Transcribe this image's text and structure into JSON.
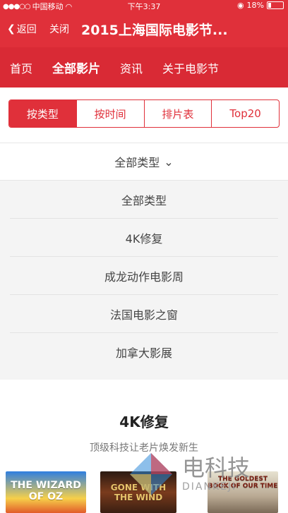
{
  "statusbar": {
    "carrier": "中国移动",
    "time": "下午3:37",
    "battery": "18%"
  },
  "navbar": {
    "back_label": "返回",
    "close_label": "关闭",
    "title": "2015上海国际电影节..."
  },
  "topmenu": {
    "items": [
      {
        "label": "首页"
      },
      {
        "label": "全部影片"
      },
      {
        "label": "资讯"
      },
      {
        "label": "关于电影节"
      }
    ]
  },
  "segmented": {
    "items": [
      {
        "label": "按类型"
      },
      {
        "label": "按时间"
      },
      {
        "label": "排片表"
      },
      {
        "label": "Top20"
      }
    ]
  },
  "dropdown": {
    "selected": "全部类型",
    "options": [
      "全部类型",
      "4K修复",
      "成龙动作电影周",
      "法国电影之窗",
      "加拿大影展"
    ]
  },
  "section": {
    "title": "4K修复",
    "subtitle": "顶级科技让老片焕发新生"
  },
  "posters": [
    {
      "text": "THE WIZARD OF OZ"
    },
    {
      "text": "GONE WITH THE WIND"
    },
    {
      "text": "THE GOLDEST BOOK OF OUR TIME"
    }
  ],
  "watermark": {
    "main": "电科技",
    "sub": "DIANKEJI"
  },
  "colors": {
    "brand_red": "#e0303a",
    "menu_red": "#d92a35",
    "bg": "#f4f4f4"
  }
}
